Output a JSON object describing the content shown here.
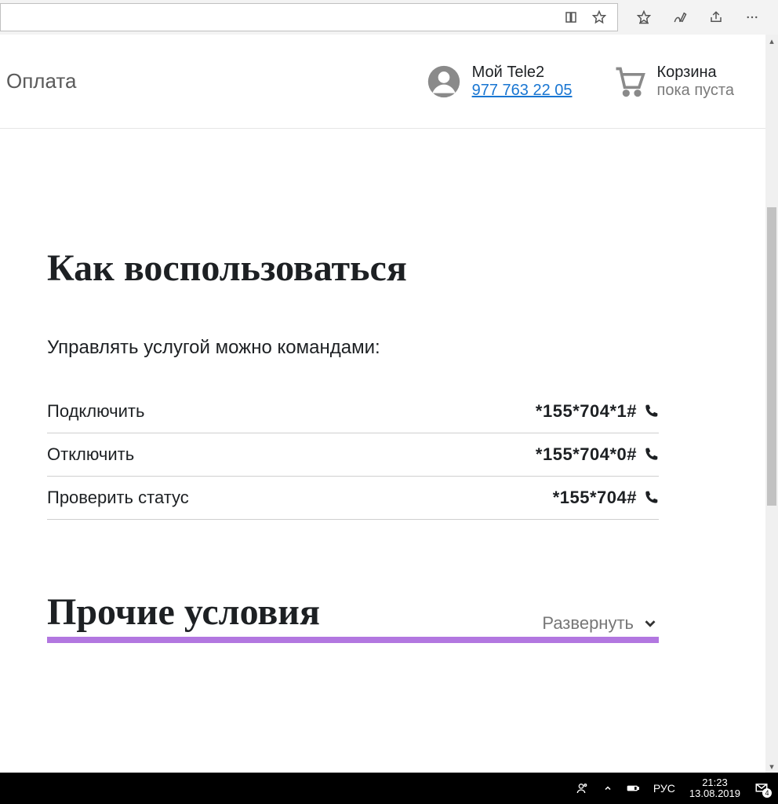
{
  "header": {
    "nav_item": "Оплата",
    "account_label": "Мой Tele2",
    "account_phone": "977 763 22 05",
    "cart_label": "Корзина",
    "cart_status": "пока пуста"
  },
  "howto": {
    "title": "Как воспользоваться",
    "intro": "Управлять услугой можно командами:",
    "rows": [
      {
        "label": "Подключить",
        "code": "*155*704*1#"
      },
      {
        "label": "Отключить",
        "code": "*155*704*0#"
      },
      {
        "label": "Проверить статус",
        "code": "*155*704#"
      }
    ]
  },
  "other": {
    "title": "Прочие условия",
    "expand": "Развернуть"
  },
  "taskbar": {
    "lang": "РУС",
    "time": "21:23",
    "date": "13.08.2019",
    "notif_count": "4"
  }
}
